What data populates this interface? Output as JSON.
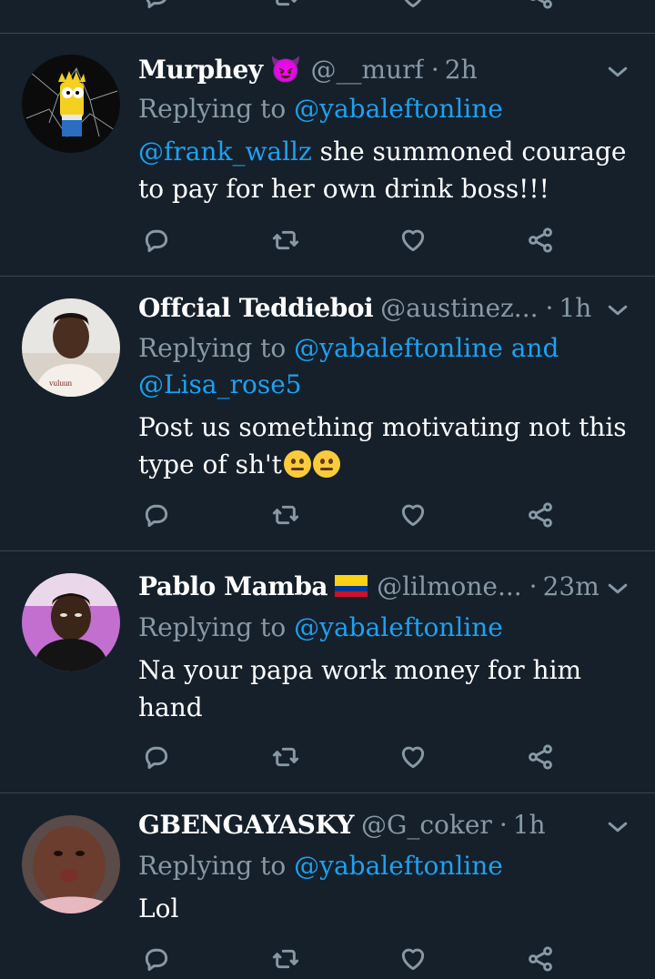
{
  "colors": {
    "background": "#15202b",
    "divider": "#38444d",
    "muted": "#8899a6",
    "link": "#1da1f2",
    "text": "#ffffff"
  },
  "actions": {
    "reply_icon": "reply-icon",
    "retweet_icon": "retweet-icon",
    "like_icon": "heart-icon",
    "share_icon": "share-icon"
  },
  "tweets": [
    {
      "name": "Murphey",
      "badge": "😈",
      "handle": "@__murf",
      "time": "2h",
      "replying_prefix": "Replying to ",
      "replying_to": "@yabaleftonline",
      "body_mention": "@frank_wallz",
      "body": " she summoned courage to pay for her own drink boss!!!"
    },
    {
      "name": "Offcial Teddieboi",
      "handle": "@austinez...",
      "time": "1h",
      "replying_prefix": "Replying to ",
      "replying_to": "@yabaleftonline",
      "replying_and": " and ",
      "replying_to_2": "@Lisa_rose5",
      "body": "Post us something motivating not this type of sh't",
      "body_emoji": "😐😐"
    },
    {
      "name": "Pablo Mamba",
      "badge": "🇨🇴",
      "handle": "@lilmone...",
      "time": "23m",
      "replying_prefix": "Replying to ",
      "replying_to": "@yabaleftonline",
      "body": "Na your papa work money for him hand"
    },
    {
      "name": "GBENGAYASKY",
      "handle": "@G_coker",
      "time": "1h",
      "replying_prefix": "Replying to ",
      "replying_to": "@yabaleftonline",
      "body": "Lol"
    }
  ]
}
